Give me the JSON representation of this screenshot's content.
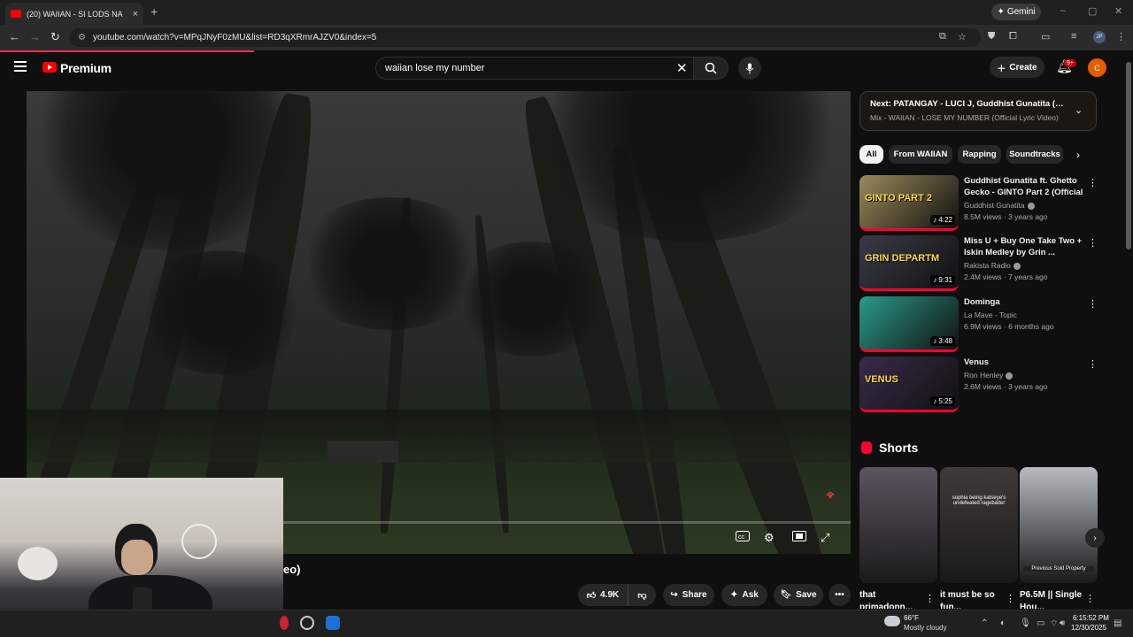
{
  "browser": {
    "tab_title": "(20) WAIIAN - SI LODS NA",
    "tab_close": "×",
    "new_tab": "+",
    "gemini_label": "Gemini",
    "url": "youtube.com/watch?v=MPqJNyF0zMU&list=RD3qXRmrAJZV0&index=5",
    "profile_initials": "JP",
    "window_controls": [
      "–",
      "▢",
      "✕"
    ]
  },
  "youtube": {
    "brand": "Premium",
    "search_query": "waiian lose my number",
    "create_label": "Create",
    "notif_badge": "9+",
    "user_initial": "C"
  },
  "video": {
    "caption_fragment": "eo)",
    "controls": [
      "cc-icon",
      "settings-icon",
      "miniplayer-icon",
      "fullscreen-icon"
    ]
  },
  "actions": {
    "like_count": "4.9K",
    "share_label": "Share",
    "ask_label": "Ask",
    "save_label": "Save",
    "more_label": "•••"
  },
  "up_next": {
    "title": "Next: PATANGAY - LUCI J, Guddhist Gunatita (Prod...",
    "subtitle": "Mix - WAIIAN - LOSE MY NUMBER (Official Lyric Video)"
  },
  "chips": [
    "All",
    "From WAIIAN",
    "Rapping",
    "Soundtracks"
  ],
  "recommended": [
    {
      "title": "Guddhist Gunatita ft. Ghetto Gecko - GINTO Part 2 (Official ...",
      "channel": "Guddhist Gunatita",
      "verified": true,
      "meta": "8.5M views · 3 years ago",
      "duration": "♪ 4:22",
      "thumb_text": "GINTO PART 2",
      "thumb_color": "#9b8a5a"
    },
    {
      "title": "Miss U + Buy One Take Two + Iskin Medley by Grin ...",
      "channel": "Rakista Radio",
      "verified": true,
      "meta": "2.4M views · 7 years ago",
      "duration": "♪ 9:31",
      "thumb_text": "GRIN DEPARTM",
      "thumb_color": "#3a3a48"
    },
    {
      "title": "Dominga",
      "channel": "La Mave - Topic",
      "verified": false,
      "meta": "6.9M views · 6 months ago",
      "duration": "♪ 3:48",
      "thumb_text": "",
      "thumb_color": "#2a9a8a"
    },
    {
      "title": "Venus",
      "channel": "Ron Henley",
      "verified": true,
      "meta": "2.6M views · 3 years ago",
      "duration": "♪ 5:25",
      "thumb_text": "VENUS",
      "thumb_color": "#3a2a4a"
    }
  ],
  "shorts": {
    "heading": "Shorts",
    "items": [
      {
        "title": "that primadonn...",
        "color": "#5a5560"
      },
      {
        "title": "it must be so fun...",
        "color": "#3e3a38",
        "caption": "sophia being katseye's undefeated ragebaiter"
      },
      {
        "title": "P6.5M || Single Hou...",
        "color": "#b8bcc0",
        "caption": "Previous Sold Property"
      }
    ]
  },
  "taskbar": {
    "temp": "66°F",
    "weather": "Mostly cloudy",
    "time": "6:15:52 PM",
    "date": "12/30/2025"
  }
}
